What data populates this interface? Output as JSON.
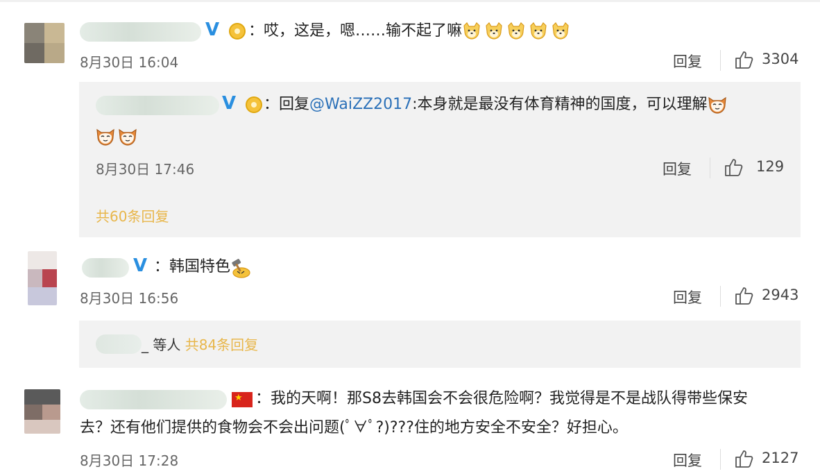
{
  "comments": [
    {
      "text": "：哎，这是，嗯……输不起了嘛",
      "time": "8月30日 16:04",
      "reply_label": "回复",
      "likes": "3304",
      "emoji_count": 5,
      "sub_reply": {
        "prefix": "：回复",
        "mention": "@WaiZZ2017",
        "text": ":本身就是最没有体育精神的国度，可以理解",
        "time": "8月30日 17:46",
        "reply_label": "回复",
        "likes": "129"
      },
      "more_replies": "共60条回复"
    },
    {
      "text": "：韩国特色",
      "time": "8月30日 16:56",
      "reply_label": "回复",
      "likes": "2943",
      "more_prefix": "_ 等人",
      "more_replies": "共84条回复"
    },
    {
      "text_line1": "：我的天啊！那S8去韩国会不会很危险啊？我觉得是不是战队得带些保安",
      "text_line2": "去？还有他们提供的食物会不会出问题(ﾟ∀ﾟ?)???住的地方安全不安全？好担心。",
      "time": "8月30日 17:28",
      "reply_label": "回复",
      "likes": "2127"
    }
  ],
  "colors": {
    "link": "#2a70b8",
    "more": "#e8b64a",
    "verified": "#2a8fe0",
    "box_bg": "#f2f2f2"
  },
  "icons": [
    "thumb-up-icon",
    "verified-icon",
    "medal-icon",
    "emoji-dog",
    "emoji-cat",
    "hammer-emoji",
    "china-flag-icon"
  ]
}
